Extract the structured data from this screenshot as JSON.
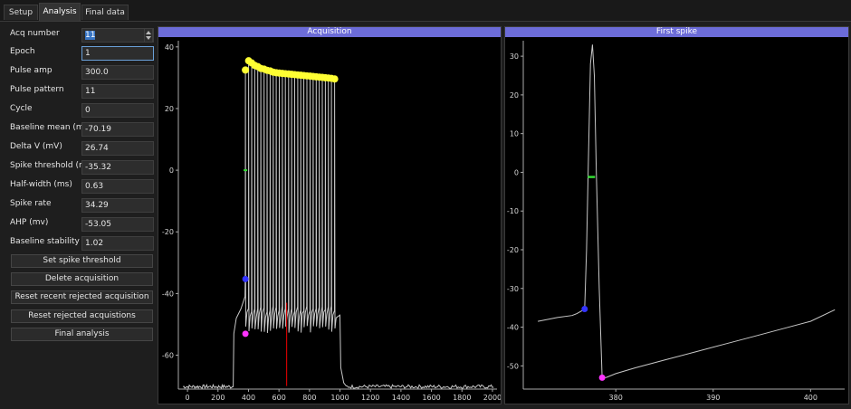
{
  "tabs": [
    {
      "label": "Setup",
      "active": false
    },
    {
      "label": "Analysis",
      "active": true
    },
    {
      "label": "Final data",
      "active": false
    }
  ],
  "form": {
    "acq_number": {
      "label": "Acq number",
      "value": "11"
    },
    "epoch": {
      "label": "Epoch",
      "value": "1"
    },
    "pulse_amp": {
      "label": "Pulse amp",
      "value": "300.0"
    },
    "pulse_pattern": {
      "label": "Pulse pattern",
      "value": "11"
    },
    "cycle": {
      "label": "Cycle",
      "value": "0"
    },
    "baseline_mean": {
      "label": "Baseline mean (mV)",
      "value": "-70.19"
    },
    "delta_v": {
      "label": "Delta V (mV)",
      "value": "26.74"
    },
    "spike_threshold": {
      "label": "Spike threshold (mV)",
      "value": "-35.32"
    },
    "half_width": {
      "label": "Half-width (ms)",
      "value": "0.63"
    },
    "spike_rate": {
      "label": "Spike rate",
      "value": "34.29"
    },
    "ahp": {
      "label": "AHP (mv)",
      "value": "-53.05"
    },
    "baseline_stability": {
      "label": "Baseline stability",
      "value": "1.02"
    }
  },
  "buttons": {
    "set_spike_threshold": "Set spike threshold",
    "delete_acquisition": "Delete acquisition",
    "reset_recent_rejected": "Reset recent rejected acquisition",
    "reset_rejected": "Reset rejected acquistions",
    "final_analysis": "Final analysis"
  },
  "colors": {
    "panel_title_bg": "#6c6cd8",
    "trace": "#c8c8c8",
    "spike_peak": "#ffff33",
    "threshold_marker": "#3333ff",
    "ahp_marker": "#ff33ff",
    "halfwidth_marker": "#33dd33",
    "baseline_marker": "#cc0000"
  },
  "chart_data": [
    {
      "type": "line",
      "title": "Acquisition",
      "xlabel": "",
      "ylabel": "",
      "xlim": [
        -60,
        2030
      ],
      "ylim": [
        -71,
        42
      ],
      "xticks": [
        0,
        200,
        400,
        600,
        800,
        1000,
        1200,
        1400,
        1600,
        1800,
        2000
      ],
      "yticks": [
        40,
        20,
        0,
        -20,
        -40,
        -60
      ],
      "grid": false,
      "baseline_mV": -70.2,
      "stim_window_ms": [
        300,
        1000
      ],
      "spike_times_ms": [
        380,
        401,
        421,
        441,
        461,
        481,
        502,
        522,
        542,
        562,
        582,
        602,
        622,
        642,
        663,
        683,
        703,
        723,
        743,
        763,
        783,
        804,
        824,
        844,
        864,
        884,
        904,
        924,
        944,
        965
      ],
      "spike_peaks_mV": [
        32.5,
        35.5,
        34.8,
        34.0,
        33.6,
        33.0,
        32.8,
        32.4,
        32.2,
        31.8,
        31.6,
        31.5,
        31.4,
        31.3,
        31.2,
        31.1,
        31.0,
        30.9,
        30.8,
        30.7,
        30.6,
        30.5,
        30.4,
        30.3,
        30.2,
        30.1,
        30.0,
        29.9,
        29.8,
        29.6
      ],
      "threshold_marker": {
        "x": 380,
        "y": -35.3
      },
      "ahp_marker": {
        "x": 380,
        "y": -53.05
      },
      "halfwidth_marker": {
        "x": 380,
        "y": 0
      },
      "baseline_line": {
        "x": 650,
        "y_range": [
          -70,
          -43
        ]
      }
    },
    {
      "type": "line",
      "title": "First spike",
      "xlabel": "",
      "ylabel": "",
      "xlim": [
        370.5,
        403.5
      ],
      "ylim": [
        -56,
        34
      ],
      "xticks": [
        380,
        390,
        400
      ],
      "yticks": [
        30,
        20,
        10,
        0,
        -10,
        -20,
        -30,
        -40,
        -50
      ],
      "grid": false,
      "trace": {
        "x": [
          372,
          374,
          375.5,
          376,
          376.5,
          376.8,
          377.0,
          377.2,
          377.4,
          377.6,
          377.8,
          378.0,
          378.3,
          378.6,
          379,
          380,
          382,
          385,
          388,
          391,
          394,
          397,
          400,
          402.5
        ],
        "y": [
          -38.5,
          -37.5,
          -37.0,
          -36.5,
          -35.8,
          -35.32,
          -20,
          5,
          28,
          33,
          25,
          0,
          -30,
          -53.05,
          -53,
          -52,
          -50.5,
          -48.5,
          -46.5,
          -44.5,
          -42.5,
          -40.5,
          -38.5,
          -35.5
        ]
      },
      "threshold_marker": {
        "x": 376.8,
        "y": -35.32
      },
      "ahp_marker": {
        "x": 378.6,
        "y": -53.05
      },
      "halfwidth_marker": {
        "x": 377.5,
        "y": -1.2
      }
    }
  ]
}
